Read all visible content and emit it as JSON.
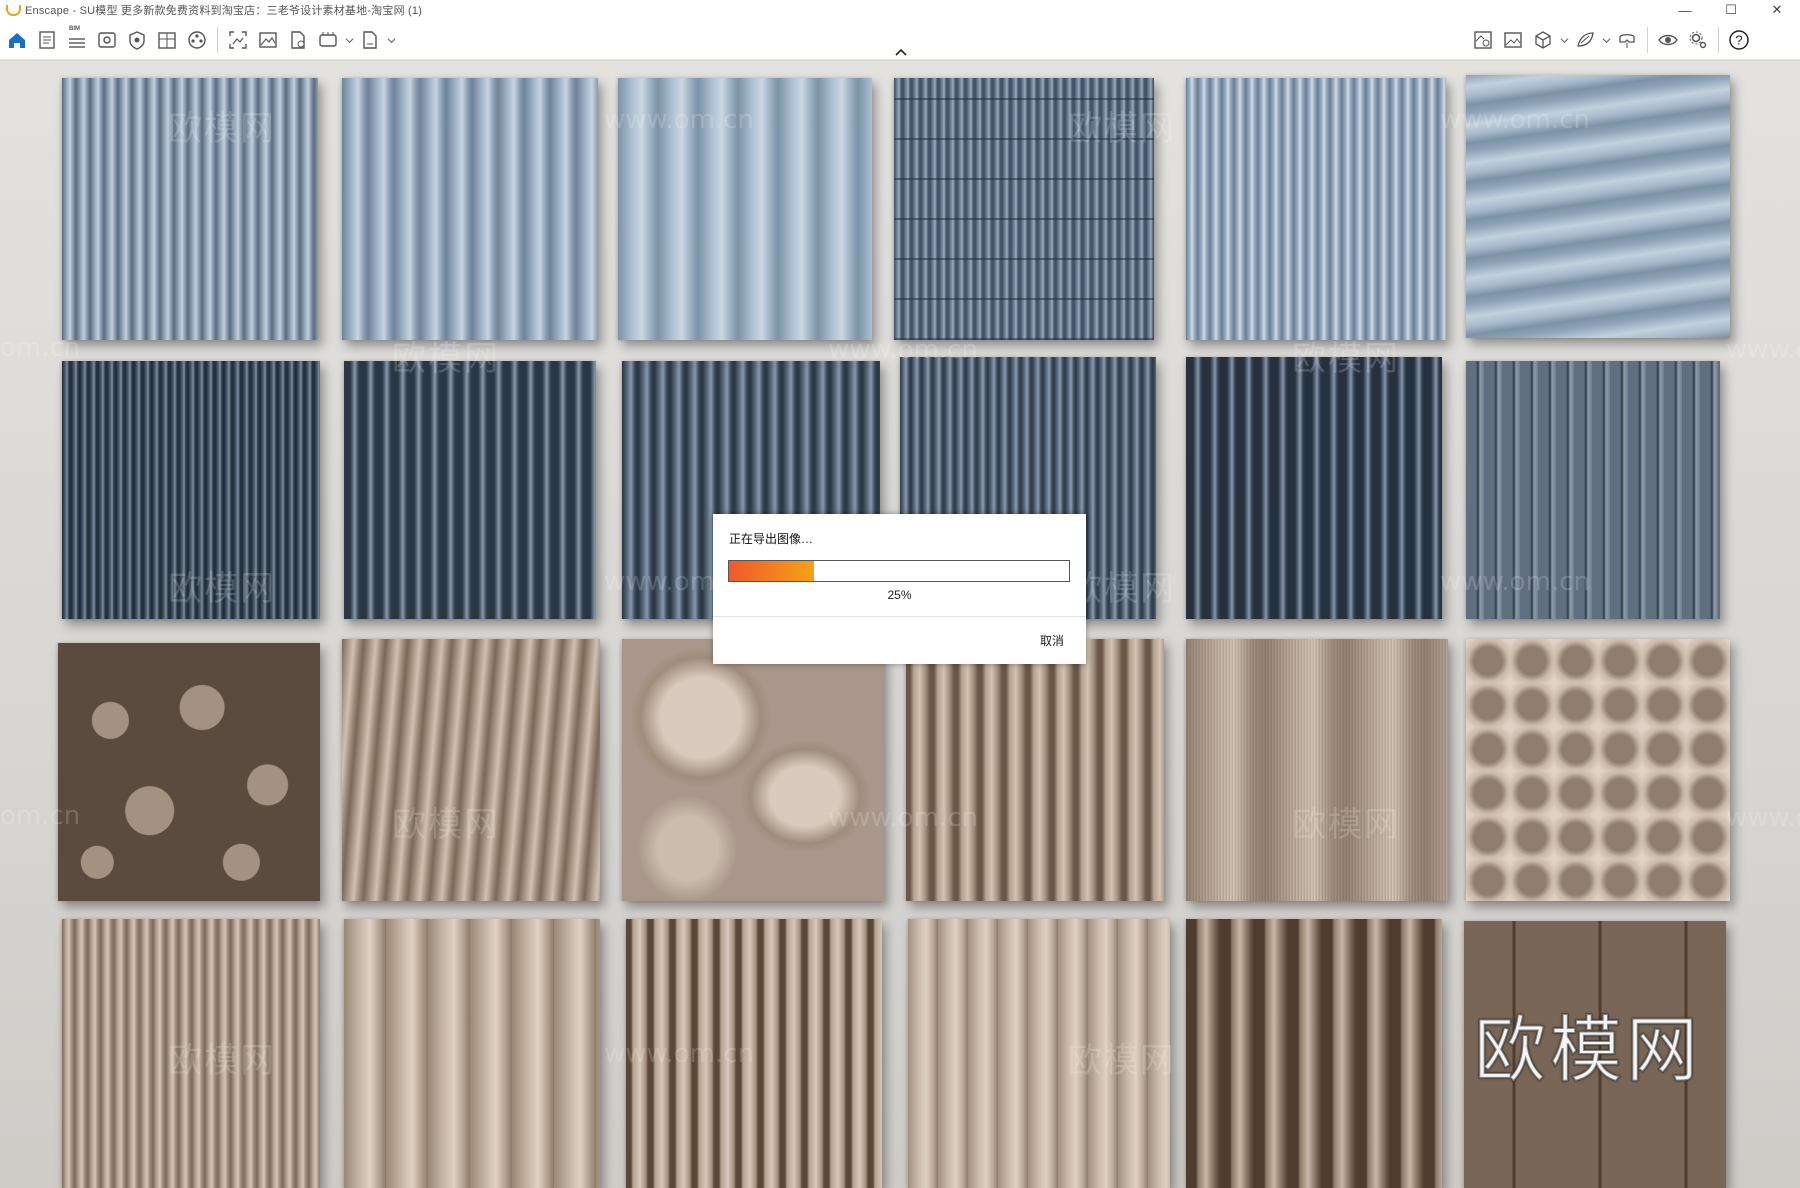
{
  "window": {
    "title": "Enscape - SU模型 更多新款免费资料到淘宝店：三老爷设计素材基地-淘宝网 (1)",
    "controls": {
      "minimize": "—",
      "maximize": "☐",
      "close": "✕"
    }
  },
  "toolbar": {
    "bim_label": "BIM",
    "left_icons": [
      "home-icon",
      "document-icon",
      "bim-icon",
      "view-icon",
      "capture-icon",
      "split-icon",
      "video-icon",
      "screenshot-icon",
      "image-icon",
      "export-icon",
      "panorama-icon",
      "file-export-icon"
    ],
    "right_icons": [
      "asset-library-icon",
      "gallery-icon",
      "cube-icon",
      "material-icon",
      "vr-headset-icon",
      "eye-icon",
      "settings-icon",
      "help-icon"
    ],
    "help_label": "?",
    "accent_color": "#1a6fc4"
  },
  "viewport": {
    "watermarks": {
      "url": "www.om.cn",
      "url_fragment_left": "om.cn",
      "url_fragment_right": "www.o",
      "brand": "欧模网"
    }
  },
  "dialog": {
    "message": "正在导出图像…",
    "progress_percent": 25,
    "progress_label": "25%",
    "cancel_label": "取消",
    "bar_color_start": "#ee5a2a",
    "bar_color_end": "#f7a118"
  }
}
